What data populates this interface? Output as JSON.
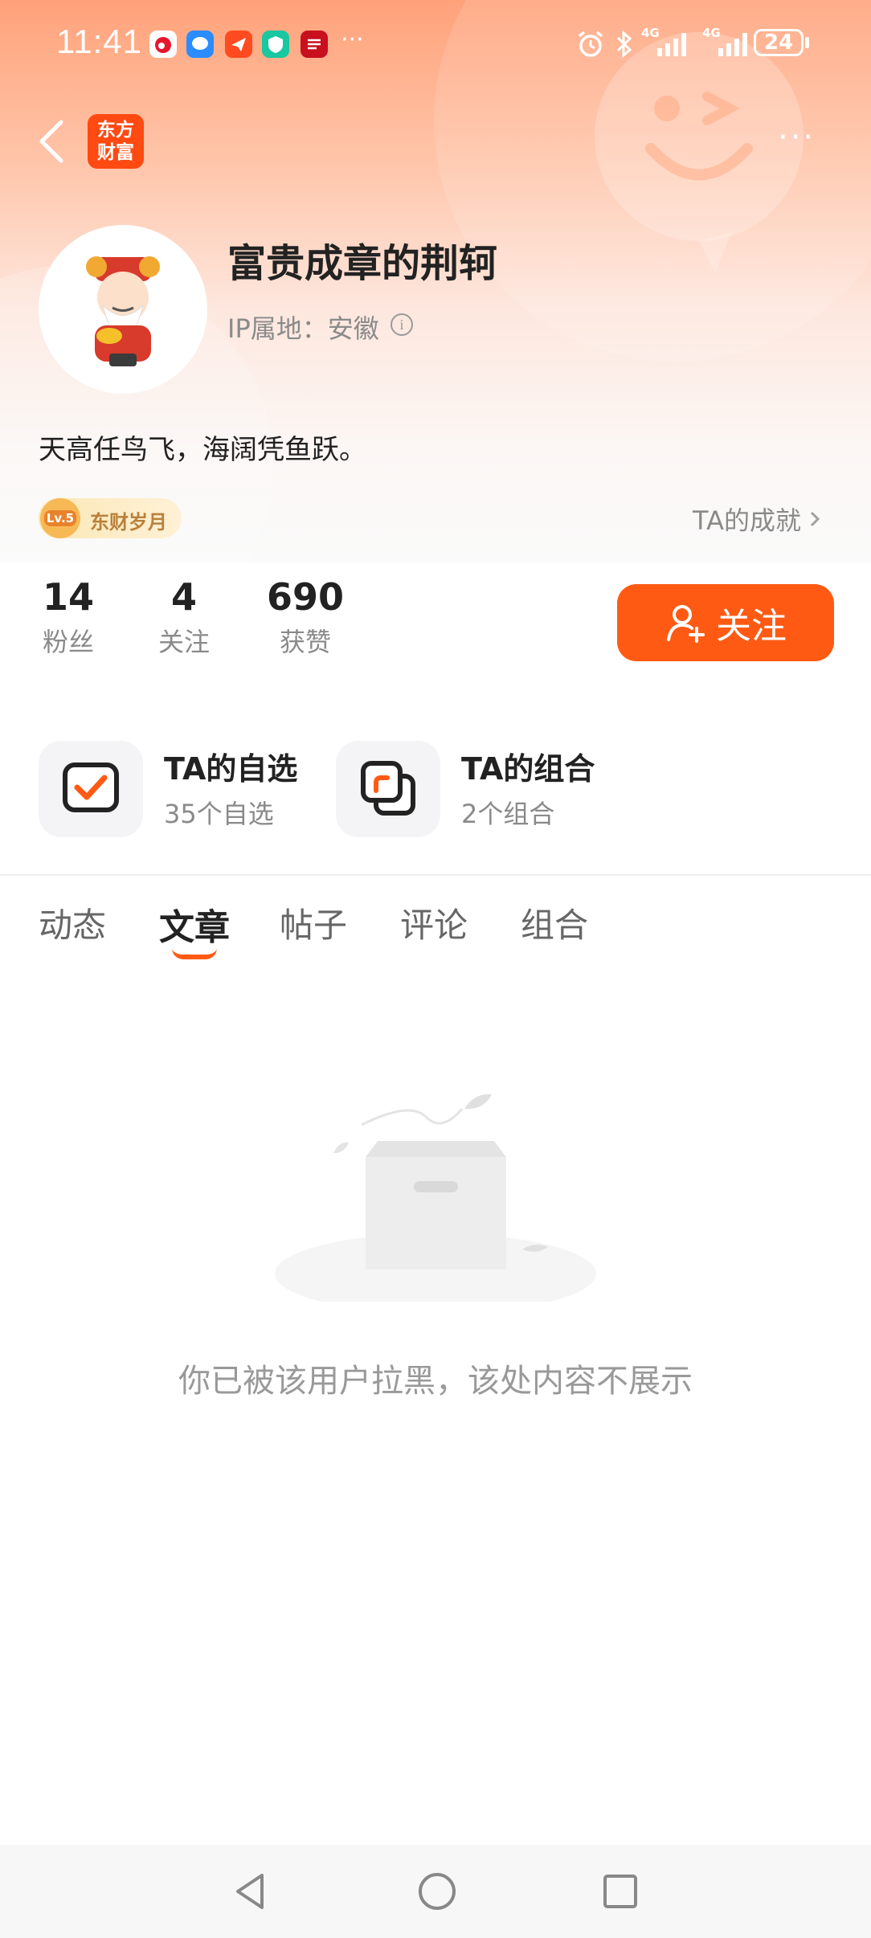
{
  "status_bar": {
    "time": "11:41",
    "more": "···",
    "network_1": "4G",
    "network_2": "4G",
    "battery": "24",
    "app_icons": [
      "weibo-icon",
      "chat-icon",
      "send-icon",
      "shield-icon",
      "news-icon"
    ]
  },
  "header": {
    "app_logo_line1": "东方",
    "app_logo_line2": "财富",
    "more": "···"
  },
  "profile": {
    "name": "富贵成章的荆轲",
    "ip_location": "IP属地：安徽",
    "bio": "天高任鸟飞，海阔凭鱼跃。",
    "level_badge": "Lv.5",
    "level_title": "东财岁月",
    "achievements_link": "TA的成就"
  },
  "stats": [
    {
      "value": "14",
      "label": "粉丝"
    },
    {
      "value": "4",
      "label": "关注"
    },
    {
      "value": "690",
      "label": "获赞"
    }
  ],
  "follow_button": "关注",
  "features": [
    {
      "title": "TA的自选",
      "subtitle": "35个自选"
    },
    {
      "title": "TA的组合",
      "subtitle": "2个组合"
    }
  ],
  "tabs": [
    {
      "label": "动态",
      "active": false
    },
    {
      "label": "文章",
      "active": true
    },
    {
      "label": "帖子",
      "active": false
    },
    {
      "label": "评论",
      "active": false
    },
    {
      "label": "组合",
      "active": false
    }
  ],
  "empty_state": {
    "message": "你已被该用户拉黑，该处内容不展示"
  },
  "colors": {
    "accent": "#ff5a14",
    "hero_top": "#ffa27a"
  }
}
